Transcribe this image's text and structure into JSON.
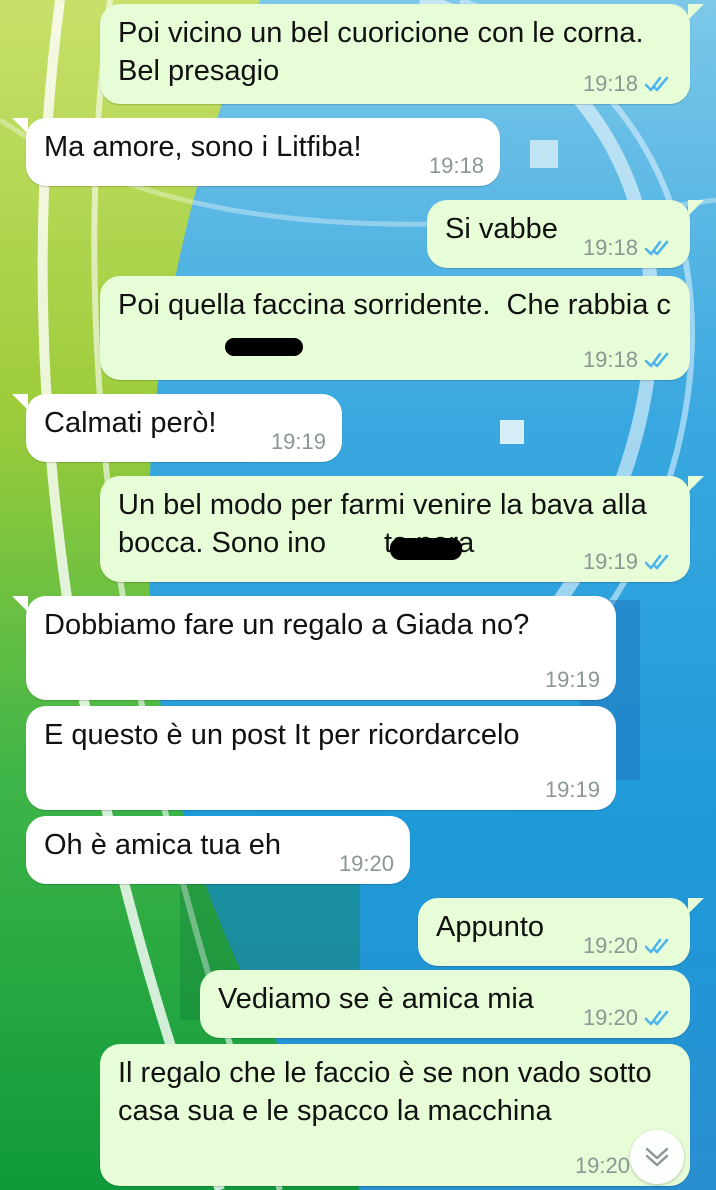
{
  "colors": {
    "outgoing_bubble": "#e7fdd8",
    "incoming_bubble": "#ffffff",
    "time_text": "#8b9794",
    "read_ticks": "#4fb6ec"
  },
  "icons": {
    "read_receipt": "double-check-icon",
    "scroll_down": "chevron-down-icon"
  },
  "messages": [
    {
      "direction": "outgoing",
      "text": "Poi vicino un bel cuoricione con le corna. Bel presagio",
      "time": "19:18",
      "status": "read"
    },
    {
      "direction": "incoming",
      "text": "Ma amore, sono i Litfiba!",
      "time": "19:18"
    },
    {
      "direction": "outgoing",
      "text": "Si vabbe",
      "time": "19:18",
      "status": "read"
    },
    {
      "direction": "outgoing",
      "text": "Poi quella faccina sorridente.  Che rabbia c",
      "time": "19:18",
      "status": "read"
    },
    {
      "direction": "incoming",
      "text": "Calmati però!",
      "time": "19:19"
    },
    {
      "direction": "outgoing",
      "text": "Un bel modo per farmi venire la bava alla bocca. Sono ino",
      "text_after_redaction": "ta nera",
      "time": "19:19",
      "status": "read"
    },
    {
      "direction": "incoming",
      "text": "Dobbiamo fare un regalo a Giada no?",
      "time": "19:19"
    },
    {
      "direction": "incoming",
      "text": "E questo è un post It per ricordarcelo",
      "time": "19:19"
    },
    {
      "direction": "incoming",
      "text": "Oh è amica tua eh",
      "time": "19:20"
    },
    {
      "direction": "outgoing",
      "text": "Appunto",
      "time": "19:20",
      "status": "read"
    },
    {
      "direction": "outgoing",
      "text": "Vediamo se è amica mia",
      "time": "19:20",
      "status": "read"
    },
    {
      "direction": "outgoing",
      "text": "Il regalo che le faccio è se non vado sotto casa sua e le spacco la macchina",
      "time": "19:20"
    }
  ]
}
